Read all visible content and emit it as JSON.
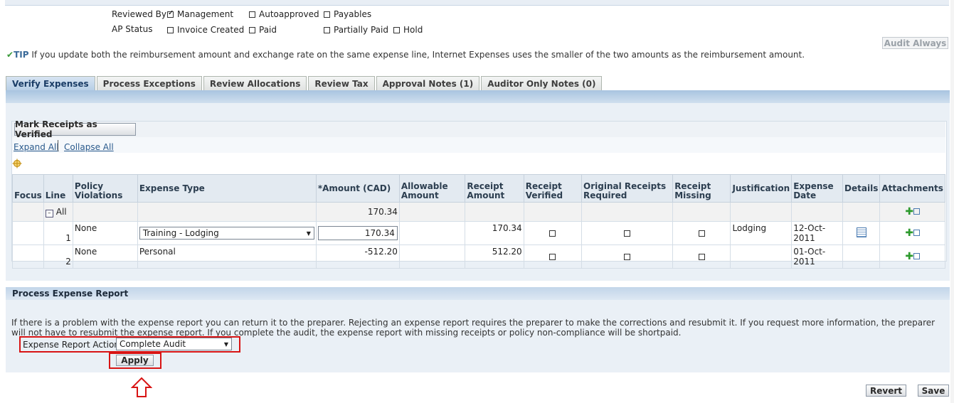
{
  "filters": {
    "reviewed_by_label": "Reviewed By",
    "reviewed_by": [
      {
        "label": "Management",
        "checked": true
      },
      {
        "label": "Autoapproved",
        "checked": false
      },
      {
        "label": "Payables",
        "checked": false
      }
    ],
    "ap_status_label": "AP Status",
    "ap_status": [
      {
        "label": "Invoice Created",
        "checked": false
      },
      {
        "label": "Paid",
        "checked": false
      },
      {
        "label": "Partially Paid",
        "checked": false
      },
      {
        "label": "Hold",
        "checked": false
      }
    ]
  },
  "audit_always_label": "Audit Always",
  "tip": {
    "label": "TIP",
    "text": "If you update both the reimbursement amount and exchange rate on the same expense line, Internet Expenses uses the smaller of the two amounts as the reimbursement amount."
  },
  "tabs": [
    {
      "label": "Verify Expenses",
      "active": true
    },
    {
      "label": "Process Exceptions",
      "active": false
    },
    {
      "label": "Review Allocations",
      "active": false
    },
    {
      "label": "Review Tax",
      "active": false
    },
    {
      "label": "Approval Notes (1)",
      "active": false
    },
    {
      "label": "Auditor Only Notes (0)",
      "active": false
    }
  ],
  "mark_receipts_label": "Mark Receipts as Verified",
  "expand_all": "Expand All",
  "collapse_all": "Collapse All",
  "table": {
    "headers": {
      "focus": "Focus",
      "line": "Line",
      "policy": "Policy Violations",
      "type": "Expense Type",
      "amount": "*Amount (CAD)",
      "allowable": "Allowable Amount",
      "receipt_amount": "Receipt Amount",
      "receipt_verified": "Receipt Verified",
      "original_required": "Original Receipts Required",
      "receipt_missing": "Receipt Missing",
      "justification": "Justification",
      "expense_date": "Expense Date",
      "details": "Details",
      "attachments": "Attachments"
    },
    "all_label": "All",
    "all_amount": "170.34",
    "rows": [
      {
        "line": "1",
        "policy": "None",
        "type": "Training - Lodging",
        "amount": "170.34",
        "receipt_amount": "170.34",
        "justification": "Lodging",
        "date": "12-Oct-2011"
      },
      {
        "line": "2",
        "policy": "None",
        "type": "Personal",
        "amount": "-512.20",
        "receipt_amount": "512.20",
        "justification": "",
        "date": "01-Oct-2011"
      }
    ]
  },
  "process": {
    "title": "Process Expense Report",
    "description": "If there is a problem with the expense report you can return it to the preparer. Rejecting an expense report requires the preparer to make the corrections and resubmit it. If you request more information, the preparer will not have to resubmit the expense report. If you complete the audit, the expense report with missing receipts or policy non-compliance will be shortpaid.",
    "action_label": "Expense Report Action",
    "action_value": "Complete Audit",
    "apply_label": "Apply"
  },
  "footer": {
    "revert_label": "Revert",
    "save_label": "Save"
  },
  "colors": {
    "highlight": "#d81414",
    "tab_active": "#b7cfe6",
    "add_icon": "#2e9a2e"
  }
}
